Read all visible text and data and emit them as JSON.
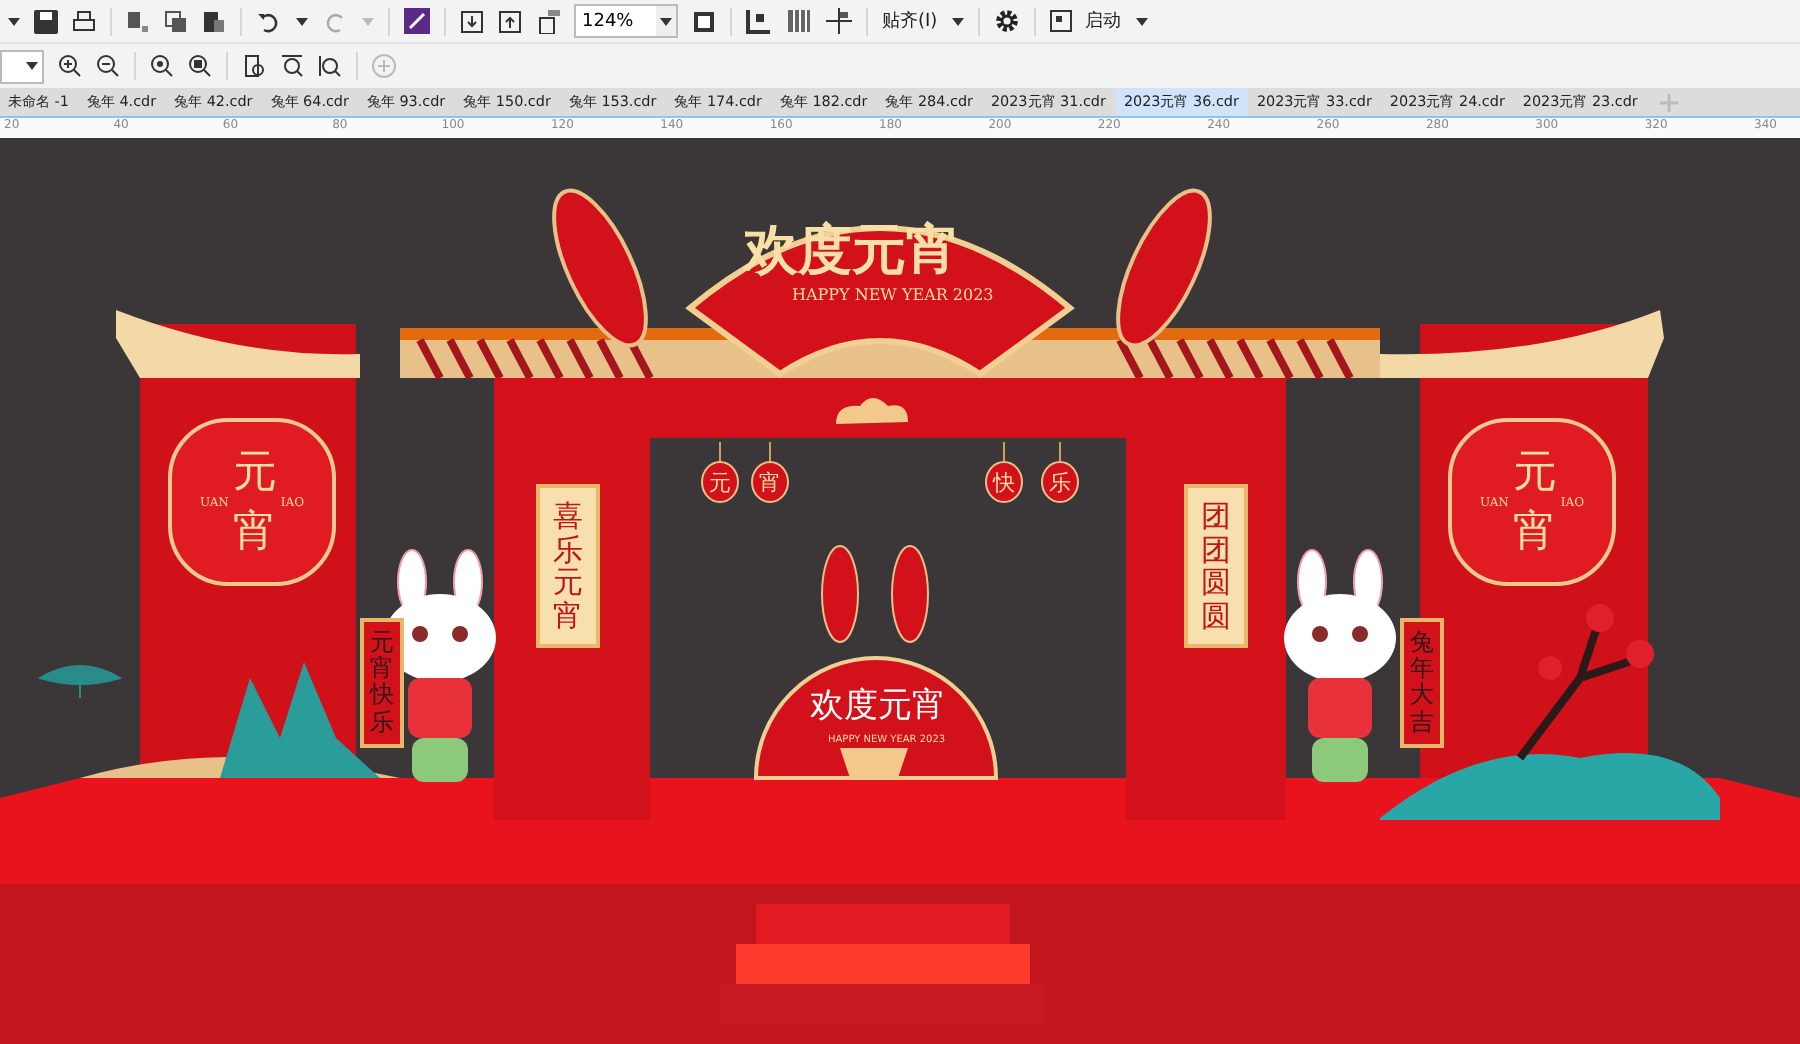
{
  "toolbar": {
    "zoom": "124%",
    "snap_label": "贴齐(I)",
    "launch_label": "启动"
  },
  "tabs": [
    {
      "label": "未命名 -1",
      "selected": false
    },
    {
      "label": "兔年 4.cdr",
      "selected": false
    },
    {
      "label": "兔年 42.cdr",
      "selected": false
    },
    {
      "label": "兔年 64.cdr",
      "selected": false
    },
    {
      "label": "兔年 93.cdr",
      "selected": false
    },
    {
      "label": "兔年 150.cdr",
      "selected": false
    },
    {
      "label": "兔年 153.cdr",
      "selected": false
    },
    {
      "label": "兔年 174.cdr",
      "selected": false
    },
    {
      "label": "兔年 182.cdr",
      "selected": false
    },
    {
      "label": "兔年 284.cdr",
      "selected": false
    },
    {
      "label": "2023元宵 31.cdr",
      "selected": false
    },
    {
      "label": "2023元宵 36.cdr",
      "selected": true
    },
    {
      "label": "2023元宵 33.cdr",
      "selected": false
    },
    {
      "label": "2023元宵 24.cdr",
      "selected": false
    },
    {
      "label": "2023元宵 23.cdr",
      "selected": false
    }
  ],
  "ruler": [
    "20",
    "40",
    "60",
    "80",
    "100",
    "120",
    "140",
    "160",
    "180",
    "200",
    "220",
    "240",
    "260",
    "280",
    "300",
    "320",
    "340"
  ],
  "artwork": {
    "title": "欢度元宵",
    "subtitle": "HAPPY NEW YEAR 2023",
    "side_panels": [
      {
        "title": "元宵",
        "left": "UAN",
        "right": "IAO"
      },
      {
        "title": "元宵",
        "left": "UAN",
        "right": "IAO"
      }
    ],
    "scrolls": [
      "喜乐元宵",
      "团团圆圆"
    ],
    "lanterns": [
      "元",
      "宵",
      "快",
      "乐"
    ],
    "rabbit_scrolls": [
      "元宵快乐",
      "兔年大吉"
    ],
    "center_sign": {
      "title": "欢度元宵",
      "subtitle": "HAPPY NEW YEAR 2023"
    }
  }
}
